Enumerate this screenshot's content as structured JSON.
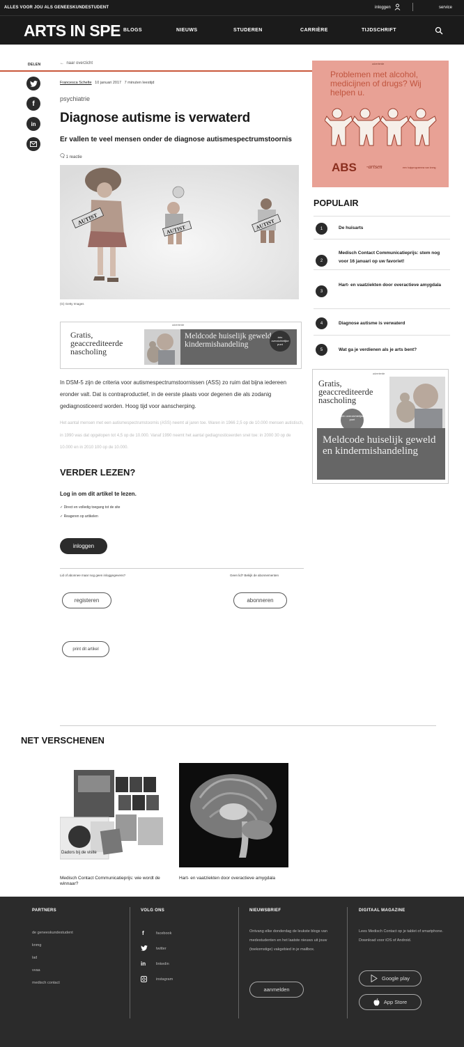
{
  "topbar": {
    "tagline": "ALLES VOOR JOU ALS GENEESKUNDESTUDENT",
    "login": "inloggen",
    "service": "service"
  },
  "nav": {
    "logo": "ARTS IN SPE",
    "items": [
      "BLOGS",
      "NIEUWS",
      "STUDEREN",
      "CARRIÈRE",
      "TIJDSCHRIFT"
    ]
  },
  "share": {
    "label": "DELEN",
    "icons": [
      "twitter-icon",
      "facebook-icon",
      "linkedin-icon",
      "email-icon"
    ]
  },
  "article": {
    "back_link": "naar overzicht",
    "author": "Francesca Schelte",
    "date": "10 januari 2017",
    "read_time": "7 minuten leestijd",
    "category": "psychiatrie",
    "title": "Diagnose autisme is verwaterd",
    "subtitle": "Er vallen te veel mensen onder de diagnose autismespectrumstoornis",
    "reactions": "1 reactie",
    "image_labels": [
      "AUTIST",
      "AUTIST",
      "AUTIST"
    ],
    "image_caption": "(G) Getty Images",
    "intro": "In DSM-5 zijn de criteria voor autismespectrumstoornissen (ASS) zo ruim dat bijna iedereen eronder valt. Dat is contraproductief, in de eerste plaats voor degenen die als zodanig gediagnosticeerd worden. Hoog tijd voor aanscherping.",
    "faded_text": "Het aantal mensen met een autismespectrumstoornis (ASS) neemt al jaren toe. Waren in 1966 2,5 op de 10.000 mensen autistisch, in 1990 was dat opgelopen tot 4,5 op de 10.000. Vanaf 1990 neemt het aantal gediagnosticeerden snel toe: in 2000 30 op de 10.000 en in 2010 100 op de 10.000."
  },
  "inline_ad": {
    "label": "advertentie",
    "left_text": "Gratis, geaccrediteerde nascholing",
    "badge": "één overzichtelijke punt",
    "right_text": "Meldcode huiselijk geweld en kindermishandeling"
  },
  "read_more": {
    "title": "VERDER LEZEN?",
    "login_heading": "Log in om dit artikel te lezen.",
    "checks": [
      "✓ Direct en volledig toegang tot de site",
      "✓ Reageren op artikelen"
    ],
    "login_button": "inloggen",
    "left_note": "Lid of abonnee maar nog geen inloggegevens?",
    "right_note": "Geen lid? Bekijk de abonnementen",
    "register_button": "registeren",
    "subscribe_button": "abonneren",
    "print_button": "print dit artikel"
  },
  "side_ad": {
    "label": "advertentie",
    "message": "Problemen met alcohol, medicijnen of drugs? Wij helpen u.",
    "brand": "ABS",
    "brand_sub": "-artsen",
    "tiny": "een hulpprogramma van knmg"
  },
  "popular": {
    "title": "POPULAIR",
    "items": [
      {
        "num": "1",
        "text": "De huisarts"
      },
      {
        "num": "2",
        "text": "Medisch Contact Communicatieprijs: stem nog voor 16 januari op uw favoriet!"
      },
      {
        "num": "3",
        "text": "Hart- en vaatziekten door overactieve amygdala"
      },
      {
        "num": "4",
        "text": "Diagnose autisme is verwaterd"
      },
      {
        "num": "5",
        "text": "Wat ga je verdienen als je arts bent?"
      }
    ]
  },
  "side_ad2": {
    "label": "advertentie",
    "left_text": "Gratis, geaccrediteerde nascholing",
    "badge": "één overzichtelijke punt",
    "dark_text": "Meldcode huiselijk geweld en kindermishandeling"
  },
  "net_verschenen": {
    "title": "NET VERSCHENEN",
    "items": [
      {
        "caption": "Medisch Contact Communicatieprijs: wie wordt de winnaar?",
        "image_text": "Dadors bij de visite"
      },
      {
        "caption": "Hart- en vaatziekten door overactieve amygdala"
      }
    ]
  },
  "footer": {
    "partners": {
      "title": "PARTNERS",
      "links": [
        "de geneeskundestudent",
        "knmg",
        "lad",
        "vvaa",
        "medisch contact"
      ]
    },
    "follow": {
      "title": "VOLG ONS",
      "links": [
        {
          "icon": "f",
          "label": "facebook"
        },
        {
          "icon": "🐦",
          "label": "twitter"
        },
        {
          "icon": "in",
          "label": "linkedin"
        },
        {
          "icon": "◙",
          "label": "instagram"
        }
      ]
    },
    "newsletter": {
      "title": "NIEUWSBRIEF",
      "text": "Ontvang elke donderdag de leukste blogs van medestudenten en het laatste nieuws uit jouw (toekomstige) vakgebied in je mailbox.",
      "button": "aanmelden"
    },
    "magazine": {
      "title": "DIGITAAL MAGAZINE",
      "text": "Lees Medisch Contact op je tablet of smartphone. Download voor iOS of Android.",
      "google": "Google play",
      "apple": "App Store"
    }
  }
}
